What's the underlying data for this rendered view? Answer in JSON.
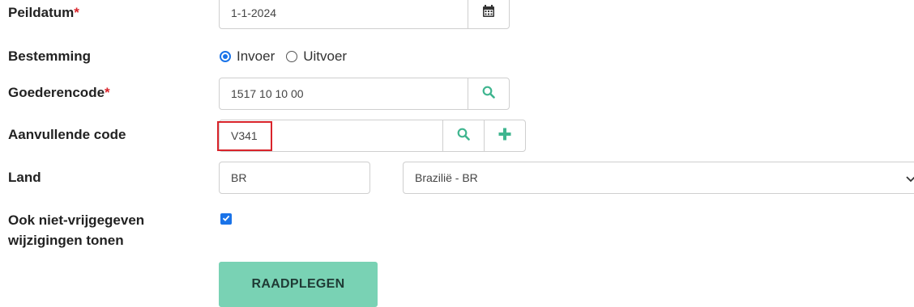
{
  "form": {
    "peildatum": {
      "label": "Peildatum",
      "required_mark": "*",
      "value": "1-1-2024",
      "icon": "calendar-icon"
    },
    "bestemming": {
      "label": "Bestemming",
      "options": [
        {
          "label": "Invoer",
          "checked": true
        },
        {
          "label": "Uitvoer",
          "checked": false
        }
      ]
    },
    "goederencode": {
      "label": "Goederencode",
      "required_mark": "*",
      "value": "1517 10 10 00",
      "icon": "search-icon"
    },
    "aanvullende_code": {
      "label": "Aanvullende code",
      "value": "V341",
      "icons": [
        "search-icon",
        "plus-icon"
      ]
    },
    "land": {
      "label": "Land",
      "code_value": "BR",
      "select_value": "Brazilië - BR",
      "icon": "chevron-down-icon"
    },
    "ook_niet_vrijgegeven": {
      "label_line1": "Ook niet-vrijgegeven",
      "label_line2": "wijzigingen tonen",
      "checked": true
    },
    "submit_label": "RAADPLEGEN"
  },
  "colors": {
    "accent_green": "#79d2b4",
    "icon_green": "#3fb58f",
    "required_red": "#d9242b",
    "highlight_red": "#d9242b",
    "radio_blue": "#1a73e8"
  }
}
